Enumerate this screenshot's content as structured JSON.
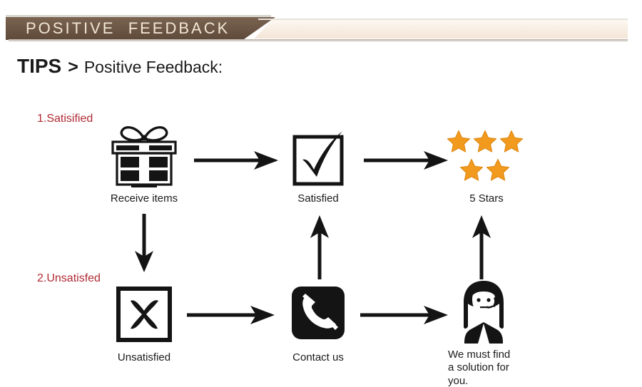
{
  "banner": {
    "title": "POSITIVE  FEEDBACK",
    "brown_color": "#6b5544",
    "cream_color": "#f7ece0",
    "text_color": "#f2e6d4"
  },
  "heading": {
    "tips": "TIPS",
    "separator": ">",
    "subject": "Positive Feedback:"
  },
  "branches": [
    {
      "number_label": "1.Satisified"
    },
    {
      "number_label": "2.Unsatisfed"
    }
  ],
  "flow": {
    "satisfied_row": [
      {
        "icon": "gift-box-icon",
        "label": "Receive items"
      },
      {
        "icon": "checkmark-box-icon",
        "label": "Satisfied"
      },
      {
        "icon": "five-stars-icon",
        "label": "5 Stars"
      }
    ],
    "unsatisfied_row": [
      {
        "icon": "x-box-icon",
        "label": "Unsatisfied"
      },
      {
        "icon": "telephone-icon",
        "label": "Contact us"
      },
      {
        "icon": "customer-service-agent-icon",
        "label": "We must find\na solution for\nyou."
      }
    ]
  },
  "colors": {
    "star": "#f29a1e",
    "star_stroke": "#e08b15",
    "red_text": "#b02a33",
    "ink": "#141414",
    "background": "#ffffff"
  },
  "stars": {
    "count": 5,
    "top_row": 3,
    "bottom_row": 2
  },
  "arrows": [
    {
      "name": "receive-to-satisfied",
      "direction": "right"
    },
    {
      "name": "satisfied-to-stars",
      "direction": "right"
    },
    {
      "name": "receive-to-unsatisfied",
      "direction": "down"
    },
    {
      "name": "unsatisfied-to-contact",
      "direction": "right"
    },
    {
      "name": "contact-to-satisfied",
      "direction": "up"
    },
    {
      "name": "contact-to-agent",
      "direction": "right"
    },
    {
      "name": "agent-to-stars",
      "direction": "up"
    }
  ]
}
